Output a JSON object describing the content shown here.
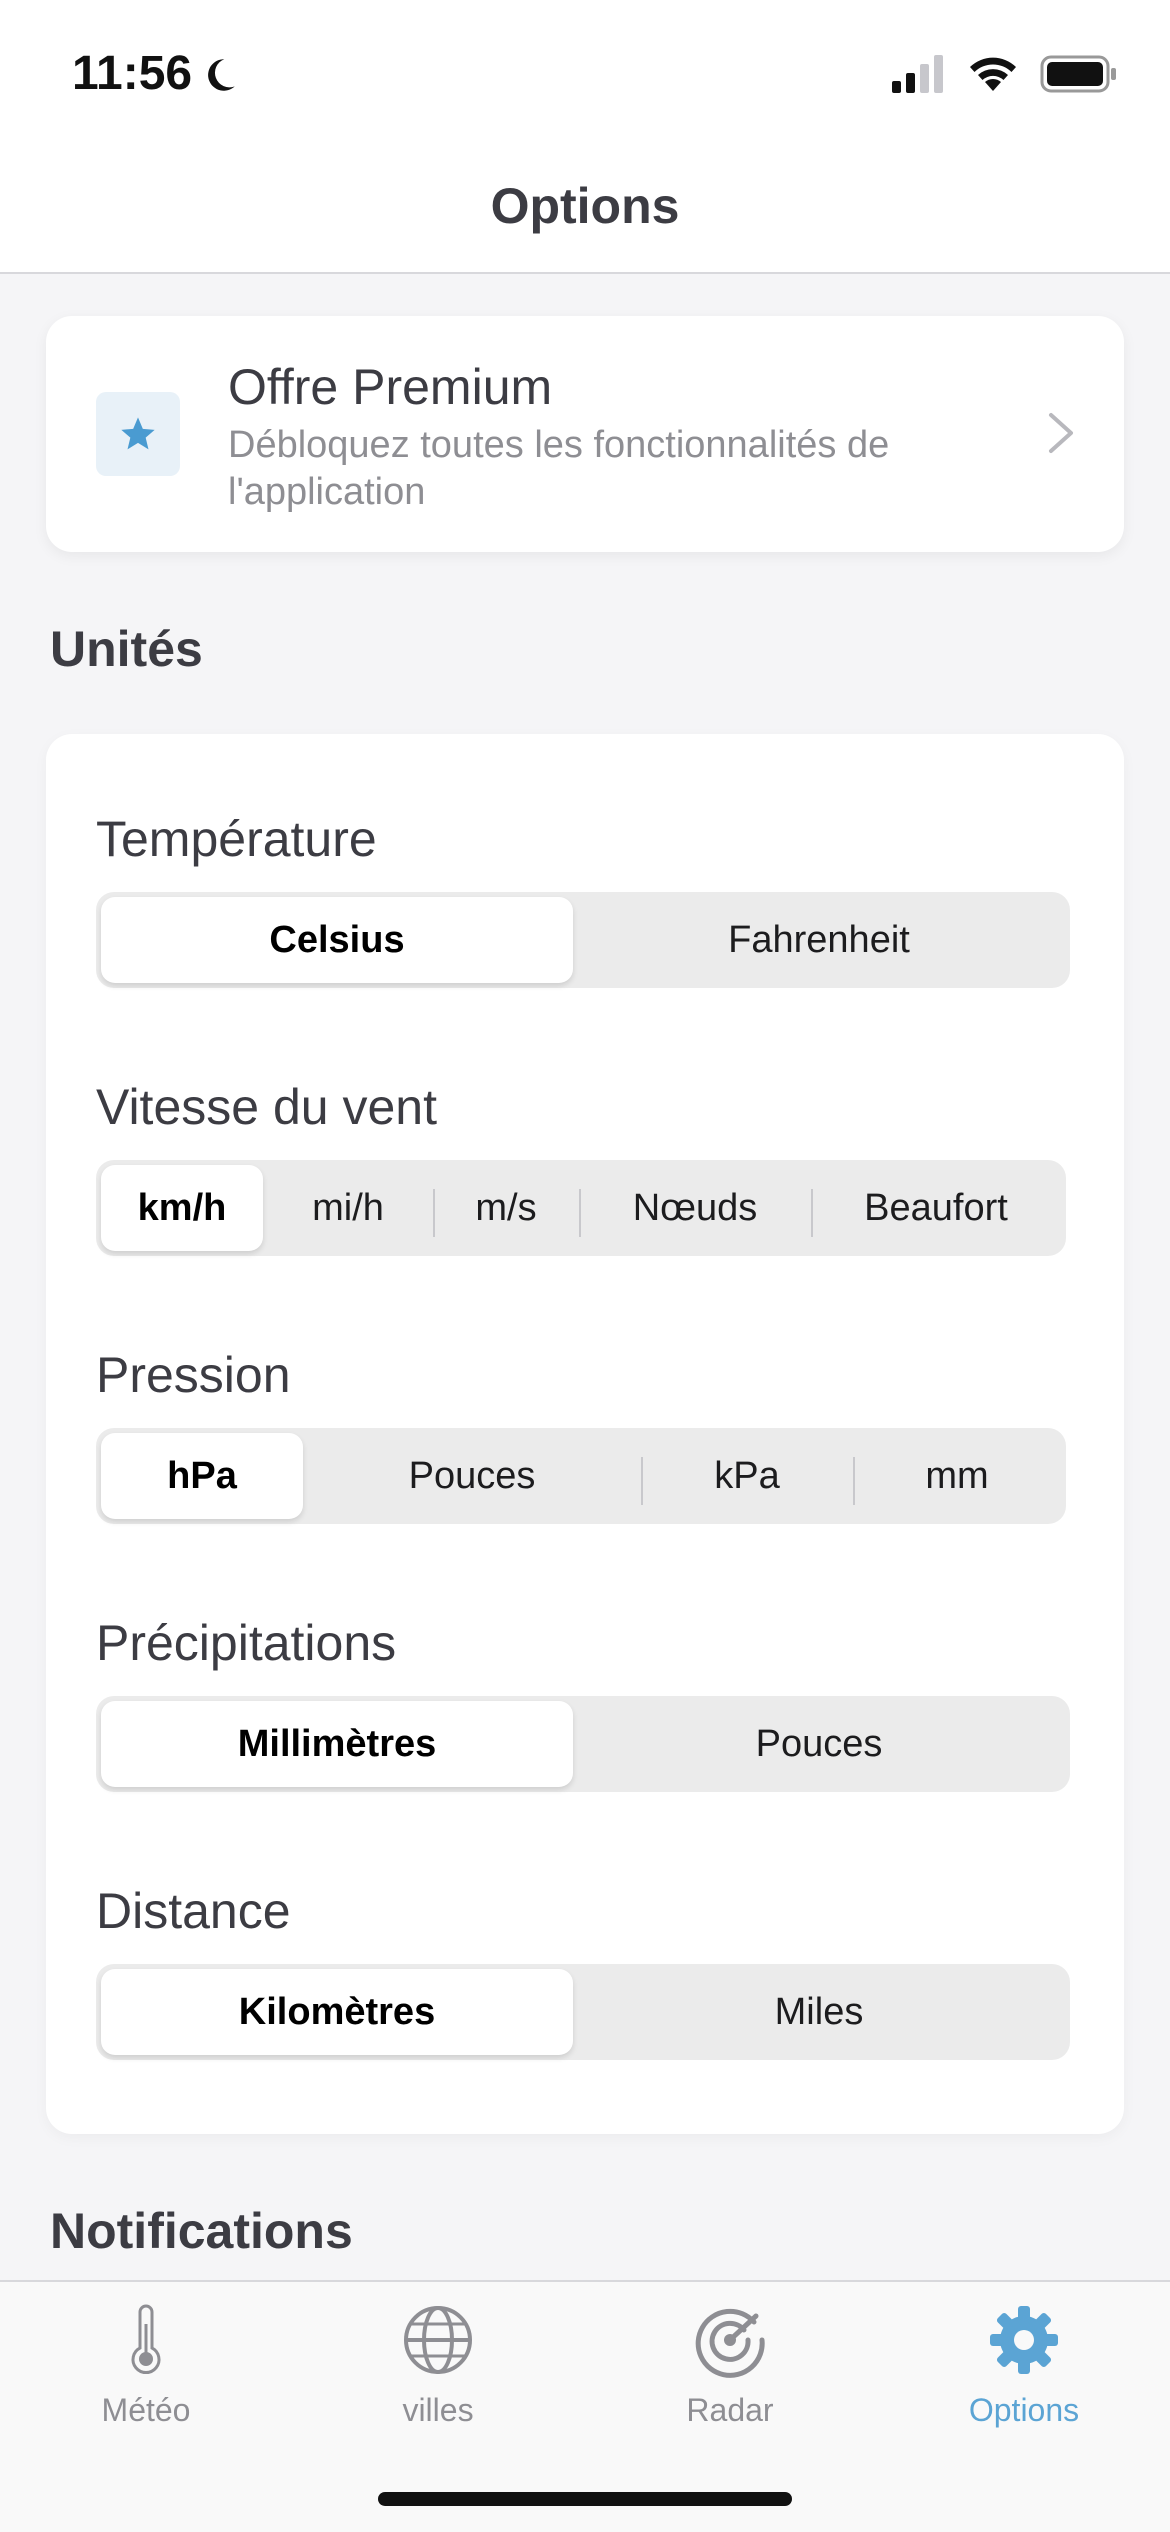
{
  "status_bar": {
    "time": "11:56",
    "icons": [
      "moon-icon",
      "cellular-signal-icon",
      "wifi-icon",
      "battery-icon"
    ]
  },
  "header": {
    "title": "Options"
  },
  "premium": {
    "icon": "star-icon",
    "title": "Offre Premium",
    "subtitle": "Débloquez toutes les fonctionnalités de l'application"
  },
  "sections": {
    "units_title": "Unités",
    "notifications_title": "Notifications"
  },
  "units": {
    "temperature": {
      "label": "Température",
      "options": [
        "Celsius",
        "Fahrenheit"
      ],
      "selected": "Celsius"
    },
    "wind": {
      "label": "Vitesse du vent",
      "options": [
        "km/h",
        "mi/h",
        "m/s",
        "Nœuds",
        "Beaufort"
      ],
      "selected": "km/h"
    },
    "pressure": {
      "label": "Pression",
      "options": [
        "hPa",
        "Pouces",
        "kPa",
        "mm"
      ],
      "selected": "hPa"
    },
    "precipitation": {
      "label": "Précipitations",
      "options": [
        "Millimètres",
        "Pouces"
      ],
      "selected": "Millimètres"
    },
    "distance": {
      "label": "Distance",
      "options": [
        "Kilomètres",
        "Miles"
      ],
      "selected": "Kilomètres"
    }
  },
  "tab_bar": {
    "items": [
      {
        "label": "Météo",
        "icon": "thermometer-icon"
      },
      {
        "label": "villes",
        "icon": "globe-icon"
      },
      {
        "label": "Radar",
        "icon": "radar-icon"
      },
      {
        "label": "Options",
        "icon": "gear-icon"
      }
    ],
    "active": "Options"
  },
  "colors": {
    "accent": "#5ba4d4",
    "background": "#f5f5f7",
    "card": "#ffffff",
    "segment_bg": "#ebebeb"
  }
}
